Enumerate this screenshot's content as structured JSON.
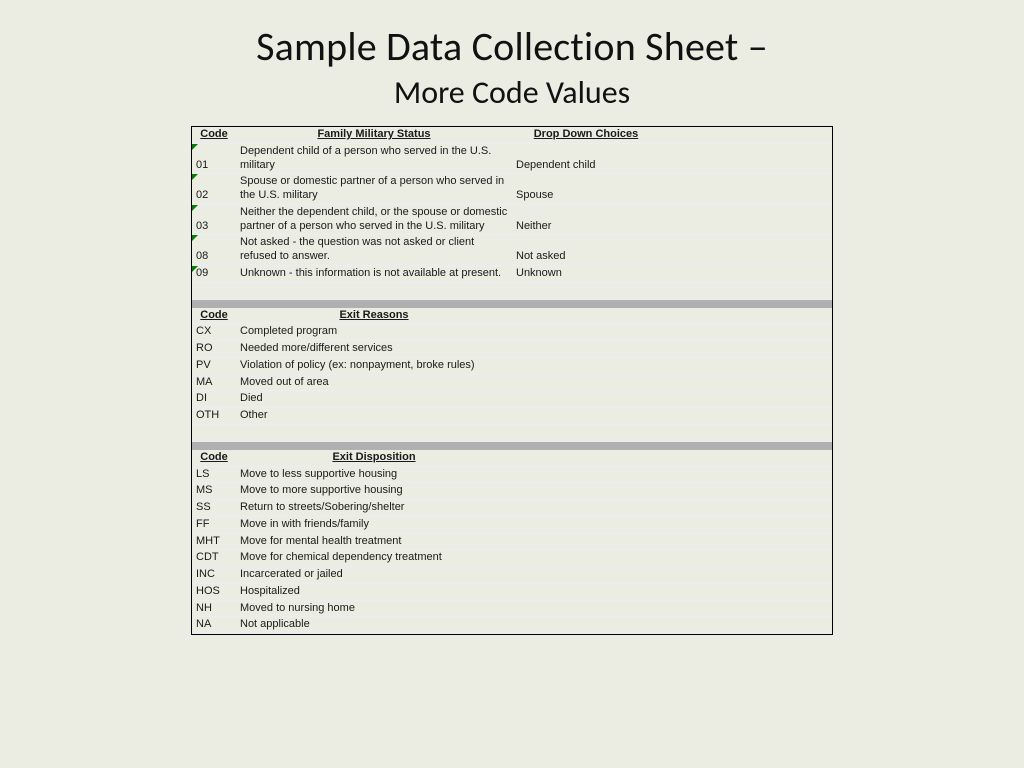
{
  "title": {
    "main": "Sample Data Collection Sheet –",
    "sub": "More Code Values"
  },
  "headers": {
    "code": "Code",
    "fms": "Family Military Status",
    "ddc": "Drop Down Choices",
    "exitReasons": "Exit Reasons",
    "exitDisposition": "Exit Disposition"
  },
  "section1": [
    {
      "code": "01",
      "desc": "Dependent child of a person who served in the U.S. military",
      "choice": "Dependent child"
    },
    {
      "code": "02",
      "desc": "Spouse or domestic partner of a person who served in the U.S. military",
      "choice": "Spouse"
    },
    {
      "code": "03",
      "desc": "Neither the dependent child, or the spouse or domestic partner of a person who served in the U.S. military",
      "choice": "Neither"
    },
    {
      "code": "08",
      "desc": "Not asked - the question was not asked or client refused to answer.",
      "choice": "Not asked"
    },
    {
      "code": "09",
      "desc": "Unknown - this information is not available at present.",
      "choice": "Unknown"
    }
  ],
  "section2": [
    {
      "code": "CX",
      "desc": "Completed program"
    },
    {
      "code": "RO",
      "desc": "Needed more/different services"
    },
    {
      "code": "PV",
      "desc": "Violation of policy (ex: nonpayment, broke rules)"
    },
    {
      "code": "MA",
      "desc": "Moved out of area"
    },
    {
      "code": "DI",
      "desc": "Died"
    },
    {
      "code": "OTH",
      "desc": "Other"
    }
  ],
  "section3": [
    {
      "code": "LS",
      "desc": "Move to less supportive housing"
    },
    {
      "code": "MS",
      "desc": "Move to more supportive housing"
    },
    {
      "code": "SS",
      "desc": "Return to streets/Sobering/shelter"
    },
    {
      "code": "FF",
      "desc": "Move in with friends/family"
    },
    {
      "code": "MHT",
      "desc": "Move for mental health treatment"
    },
    {
      "code": "CDT",
      "desc": "Move for chemical dependency treatment"
    },
    {
      "code": "INC",
      "desc": "Incarcerated or jailed"
    },
    {
      "code": "HOS",
      "desc": "Hospitalized"
    },
    {
      "code": "NH",
      "desc": "Moved to nursing home"
    },
    {
      "code": "NA",
      "desc": "Not applicable"
    }
  ]
}
